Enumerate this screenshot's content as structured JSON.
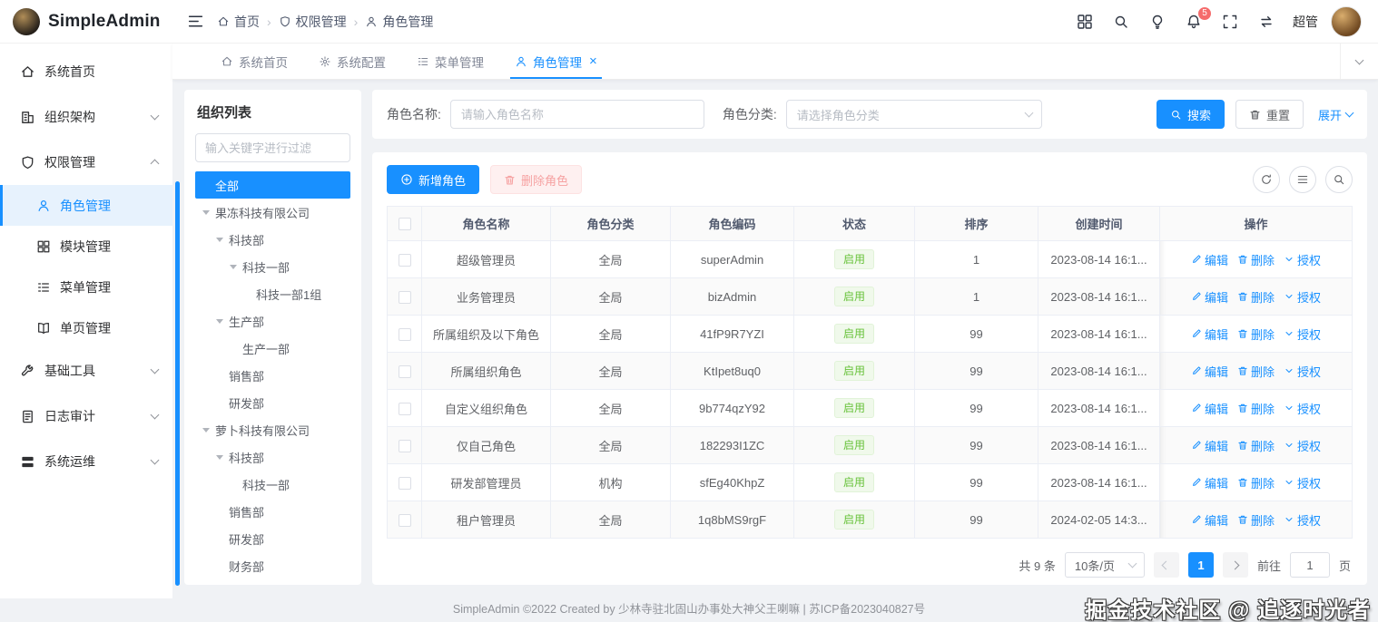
{
  "app": {
    "title": "SimpleAdmin"
  },
  "header": {
    "breadcrumb": [
      "首页",
      "权限管理",
      "角色管理"
    ],
    "username": "超管",
    "notification_badge": "5"
  },
  "tabs": {
    "items": [
      {
        "label": "系统首页"
      },
      {
        "label": "系统配置"
      },
      {
        "label": "菜单管理"
      },
      {
        "label": "角色管理"
      }
    ]
  },
  "sidebar": {
    "items": [
      {
        "label": "系统首页"
      },
      {
        "label": "组织架构"
      },
      {
        "label": "权限管理"
      },
      {
        "label": "角色管理"
      },
      {
        "label": "模块管理"
      },
      {
        "label": "菜单管理"
      },
      {
        "label": "单页管理"
      },
      {
        "label": "基础工具"
      },
      {
        "label": "日志审计"
      },
      {
        "label": "系统运维"
      }
    ]
  },
  "org_panel": {
    "title": "组织列表",
    "filter_placeholder": "输入关键字进行过滤",
    "tree": [
      {
        "label": "全部",
        "level": 0,
        "expandable": false,
        "selected": true
      },
      {
        "label": "果冻科技有限公司",
        "level": 0,
        "expandable": true
      },
      {
        "label": "科技部",
        "level": 1,
        "expandable": true
      },
      {
        "label": "科技一部",
        "level": 2,
        "expandable": true
      },
      {
        "label": "科技一部1组",
        "level": 3,
        "expandable": false
      },
      {
        "label": "生产部",
        "level": 1,
        "expandable": true
      },
      {
        "label": "生产一部",
        "level": 2,
        "expandable": false
      },
      {
        "label": "销售部",
        "level": 1,
        "expandable": false
      },
      {
        "label": "研发部",
        "level": 1,
        "expandable": false
      },
      {
        "label": "萝卜科技有限公司",
        "level": 0,
        "expandable": true
      },
      {
        "label": "科技部",
        "level": 1,
        "expandable": true
      },
      {
        "label": "科技一部",
        "level": 2,
        "expandable": false
      },
      {
        "label": "销售部",
        "level": 1,
        "expandable": false
      },
      {
        "label": "研发部",
        "level": 1,
        "expandable": false
      },
      {
        "label": "财务部",
        "level": 1,
        "expandable": false
      }
    ]
  },
  "search_form": {
    "name_label": "角色名称:",
    "name_placeholder": "请输入角色名称",
    "category_label": "角色分类:",
    "category_placeholder": "请选择角色分类",
    "search_button": "搜索",
    "reset_button": "重置",
    "expand_button": "展开"
  },
  "toolbar": {
    "add_button": "新增角色",
    "delete_button": "删除角色"
  },
  "table": {
    "headers": [
      "角色名称",
      "角色分类",
      "角色编码",
      "状态",
      "排序",
      "创建时间",
      "操作"
    ],
    "action_labels": {
      "edit": "编辑",
      "delete": "删除",
      "grant": "授权"
    },
    "rows": [
      {
        "name": "超级管理员",
        "category": "全局",
        "code": "superAdmin",
        "status": "启用",
        "sort": "1",
        "created": "2023-08-14 16:1..."
      },
      {
        "name": "业务管理员",
        "category": "全局",
        "code": "bizAdmin",
        "status": "启用",
        "sort": "1",
        "created": "2023-08-14 16:1..."
      },
      {
        "name": "所属组织及以下角色",
        "category": "全局",
        "code": "41fP9R7YZI",
        "status": "启用",
        "sort": "99",
        "created": "2023-08-14 16:1..."
      },
      {
        "name": "所属组织角色",
        "category": "全局",
        "code": "KtIpet8uq0",
        "status": "启用",
        "sort": "99",
        "created": "2023-08-14 16:1..."
      },
      {
        "name": "自定义组织角色",
        "category": "全局",
        "code": "9b774qzY92",
        "status": "启用",
        "sort": "99",
        "created": "2023-08-14 16:1..."
      },
      {
        "name": "仅自己角色",
        "category": "全局",
        "code": "182293I1ZC",
        "status": "启用",
        "sort": "99",
        "created": "2023-08-14 16:1..."
      },
      {
        "name": "研发部管理员",
        "category": "机构",
        "code": "sfEg40KhpZ",
        "status": "启用",
        "sort": "99",
        "created": "2023-08-14 16:1..."
      },
      {
        "name": "租户管理员",
        "category": "全局",
        "code": "1q8bMS9rgF",
        "status": "启用",
        "sort": "99",
        "created": "2024-02-05 14:3..."
      }
    ]
  },
  "pagination": {
    "total": "共 9 条",
    "page_size": "10条/页",
    "current_page": "1",
    "goto_label": "前往",
    "goto_value": "1",
    "goto_suffix": "页"
  },
  "footer": {
    "text": "SimpleAdmin ©2022 Created by 少林寺驻北固山办事处大神父王喇嘛 | 苏ICP备2023040827号"
  },
  "watermark": "掘金技术社区 @ 追逐时光者",
  "colors": {
    "accent": "#1890ff",
    "success": "#67c23a",
    "danger": "#f56c6c"
  }
}
